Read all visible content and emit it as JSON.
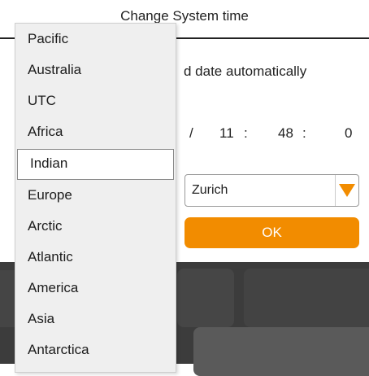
{
  "dialog": {
    "title": "Change System time",
    "auto_date_label": "d date automatically",
    "time": {
      "sep1": "/",
      "hour": "11",
      "colon1": ":",
      "minute": "48",
      "colon2": ":",
      "second": "0"
    },
    "timezone_value": "Zurich",
    "ok_label": "OK"
  },
  "dropdown": {
    "items": [
      {
        "label": "Pacific"
      },
      {
        "label": "Australia"
      },
      {
        "label": "UTC"
      },
      {
        "label": "Africa"
      },
      {
        "label": "Indian",
        "selected": true
      },
      {
        "label": "Europe"
      },
      {
        "label": "Arctic"
      },
      {
        "label": "Atlantic"
      },
      {
        "label": "America"
      },
      {
        "label": "Asia"
      },
      {
        "label": "Antarctica"
      }
    ]
  },
  "colors": {
    "accent": "#f28c00",
    "background_dark": "#3c3c3c"
  }
}
